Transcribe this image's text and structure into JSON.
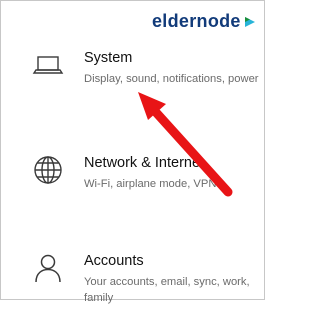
{
  "logo": {
    "text": "eldernode",
    "mark": "play-arrow-mark"
  },
  "settings": [
    {
      "title": "System",
      "description": "Display, sound, notifications, power",
      "icon": "laptop-icon"
    },
    {
      "title": "Network & Internet",
      "description": "Wi-Fi, airplane mode, VPN",
      "icon": "globe-icon"
    },
    {
      "title": "Accounts",
      "description": "Your accounts, email, sync, work, family",
      "icon": "person-icon"
    }
  ],
  "annotation": {
    "icon": "red-arrow",
    "color": "#e81416"
  },
  "colors": {
    "title": "#111111",
    "description": "#6b6b6b",
    "icon": "#3a3a3a",
    "logo": "#123b7a"
  }
}
